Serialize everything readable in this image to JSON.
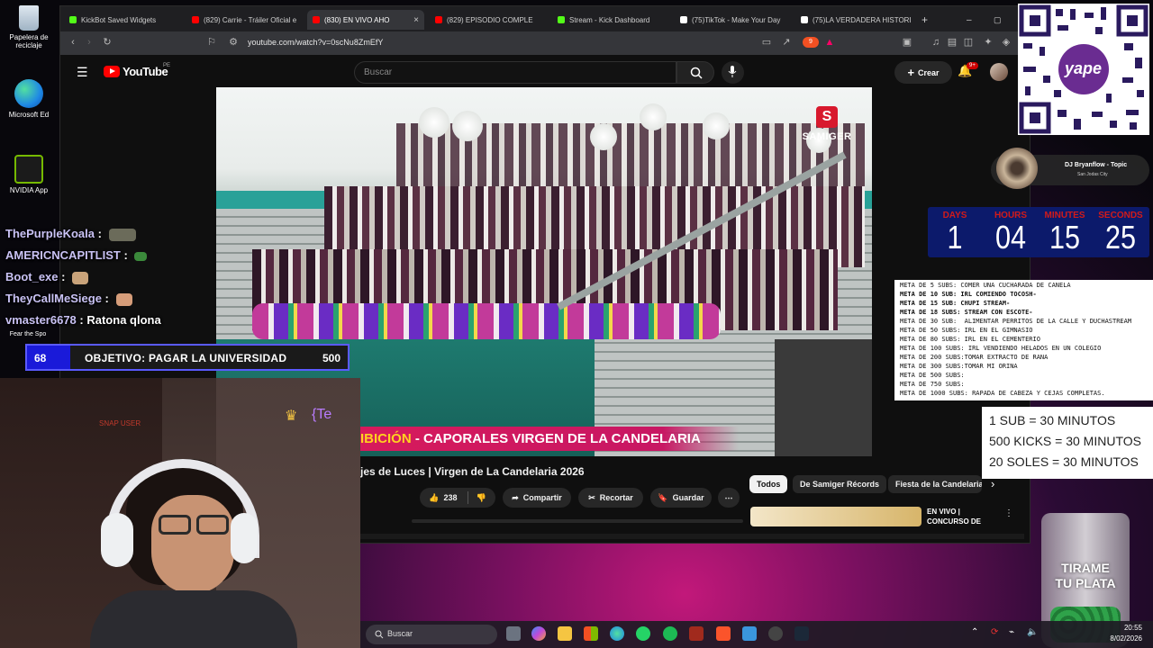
{
  "desktop": {
    "icons": [
      {
        "label": "Papelera de reciclaje"
      },
      {
        "label": "Microsoft Ed"
      },
      {
        "label": "NVIDIA App"
      },
      {
        "label": "Fear the Spo"
      }
    ]
  },
  "browser": {
    "tabs": [
      {
        "label": "KickBot Saved Widgets",
        "color": "#53fc18"
      },
      {
        "label": "(829) Carrie - Tráiler Oficial e",
        "color": "#ff0000"
      },
      {
        "label": "(830) EN VIVO AHO",
        "color": "#ff0000",
        "active": true
      },
      {
        "label": "(829) EPISODIO COMPLE",
        "color": "#ff0000"
      },
      {
        "label": "Stream - Kick Dashboard",
        "color": "#53fc18"
      },
      {
        "label": "(75)TikTok - Make Your Day",
        "color": "#ffffff"
      },
      {
        "label": "(75)LA VERDADERA HISTORI",
        "color": "#ffffff"
      }
    ],
    "url": "youtube.com/watch?v=0scNu8ZmEfY"
  },
  "youtube": {
    "logo": "YouTube",
    "region": "PE",
    "search_placeholder": "Buscar",
    "create_label": "Crear",
    "notifications": "9+",
    "video": {
      "banner_highlight": "IBICIÓN",
      "banner_text": " - CAPORALES VIRGEN DE LA CANDELARIA",
      "channel_watermark": "SAMIGER",
      "channel_badge": "S"
    },
    "title": "jes de Luces | Virgen de La Candelaria 2026",
    "likes": "238",
    "actions": {
      "share": "Compartir",
      "clip": "Recortar",
      "save": "Guardar"
    },
    "chips": [
      "Todos",
      "De Samiger Récords",
      "Fiesta de la Candelaria"
    ],
    "related": {
      "live_label": "EN VIVO |",
      "title_line2": "CONCURSO DE"
    }
  },
  "stream": {
    "chat": [
      {
        "user": "ThePurpleKoala",
        "message": "",
        "emote": "#6b6b5a"
      },
      {
        "user": "AMERICNCAPITLIST",
        "message": "",
        "emote": "#3b8a3b"
      },
      {
        "user": "Boot_exe",
        "message": "",
        "emote": "#c9a37a"
      },
      {
        "user": "TheyCallMeSiege",
        "message": "",
        "emote": "#d69d7a"
      },
      {
        "user": "vmaster6678",
        "message": "Ratona qlona",
        "emote": ""
      }
    ],
    "goal": {
      "current": "68",
      "label": "OBJETIVO: PAGAR LA UNIVERSIDAD",
      "target": "500",
      "progress": 0.136
    },
    "webcam": {
      "sign_text": "SNAP USER",
      "overlay_text": "{Te"
    },
    "countdown": {
      "labels": [
        "DAYS",
        "HOURS",
        "MINUTES",
        "SECONDS"
      ],
      "values": [
        "1",
        "04",
        "15",
        "25"
      ]
    },
    "dj": {
      "name": "DJ Bryanflow - Topic",
      "sub": "San Jodas City"
    },
    "metas": [
      {
        "text": "META DE 5 SUBS: COMER UNA CUCHARADA DE CANELA",
        "bold": false
      },
      {
        "text": "META DE 10 SUB: IRL COMIENDO TOCOSH-",
        "bold": true
      },
      {
        "text": "META DE 15 SUB: CHUPI STREAM-",
        "bold": true
      },
      {
        "text": "META DE 18 SUBS: STREAM CON ESCOTE-",
        "bold": true
      },
      {
        "text": "META DE 30 SUB:  ALIMENTAR PERRITOS DE LA CALLE Y DUCHASTREAM",
        "bold": false
      },
      {
        "text": "META DE 50 SUBS: IRL EN EL GIMNASIO",
        "bold": false
      },
      {
        "text": "META DE 80 SUBS: IRL EN EL CEMENTERIO",
        "bold": false
      },
      {
        "text": "META DE 100 SUBS: IRL VENDIENDO HELADOS EN UN COLEGIO",
        "bold": false
      },
      {
        "text": "META DE 200 SUBS:TOMAR EXTRACTO DE RANA",
        "bold": false
      },
      {
        "text": "META DE 300 SUBS:TOMAR MI ORINA",
        "bold": false
      },
      {
        "text": "META DE 500 SUBS:",
        "bold": false
      },
      {
        "text": "META DE 750 SUBS:",
        "bold": false
      },
      {
        "text": "META DE 1000 SUBS: RAPADA DE CABEZA Y CEJAS COMPLETAS.",
        "bold": false
      }
    ],
    "rates": [
      "1 SUB = 30 MINUTOS",
      "500 KICKS = 30 MINUTOS",
      "20 SOLES = 30 MINUTOS"
    ],
    "jar_text": [
      "TIRAME",
      "TU PLATA"
    ],
    "qr_label": "yape"
  },
  "taskbar": {
    "search": "Buscar",
    "time": "20:55",
    "date": "8/02/2026"
  }
}
